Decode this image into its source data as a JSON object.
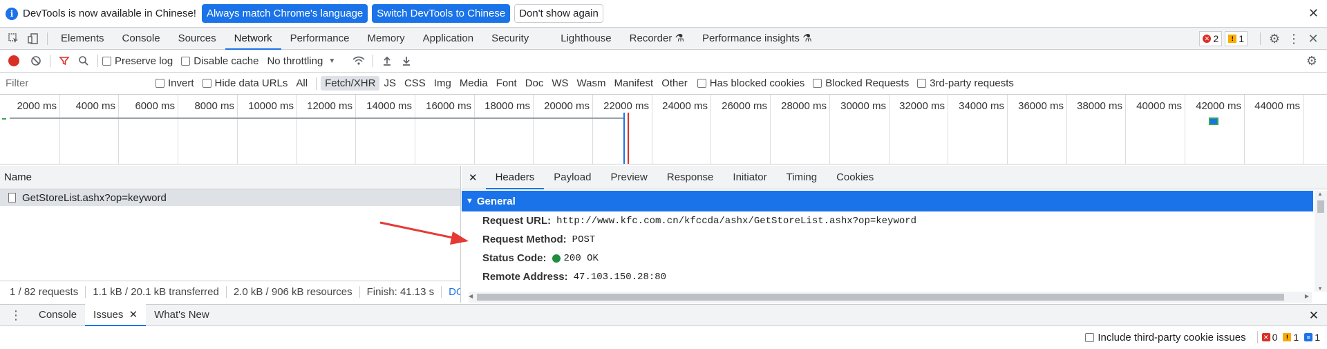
{
  "infobar": {
    "message": "DevTools is now available in Chinese!",
    "btn_match": "Always match Chrome's language",
    "btn_switch": "Switch DevTools to Chinese",
    "btn_dismiss": "Don't show again",
    "close": "✕"
  },
  "tabs": [
    "Elements",
    "Console",
    "Sources",
    "Network",
    "Performance",
    "Memory",
    "Application",
    "Security",
    "Lighthouse",
    "Recorder",
    "Performance insights"
  ],
  "active_tab": "Network",
  "counts": {
    "errors": "2",
    "warnings": "1"
  },
  "toolbar": {
    "preserve_log": "Preserve log",
    "disable_cache": "Disable cache",
    "throttling": "No throttling"
  },
  "filter": {
    "placeholder": "Filter",
    "invert": "Invert",
    "hide_data_urls": "Hide data URLs",
    "types": [
      "All",
      "Fetch/XHR",
      "JS",
      "CSS",
      "Img",
      "Media",
      "Font",
      "Doc",
      "WS",
      "Wasm",
      "Manifest",
      "Other"
    ],
    "selected_type": "Fetch/XHR",
    "has_blocked_cookies": "Has blocked cookies",
    "blocked_requests": "Blocked Requests",
    "third_party": "3rd-party requests"
  },
  "timeline": {
    "ticks": [
      "2000 ms",
      "4000 ms",
      "6000 ms",
      "8000 ms",
      "10000 ms",
      "12000 ms",
      "14000 ms",
      "16000 ms",
      "18000 ms",
      "20000 ms",
      "22000 ms",
      "24000 ms",
      "26000 ms",
      "28000 ms",
      "30000 ms",
      "32000 ms",
      "34000 ms",
      "36000 ms",
      "38000 ms",
      "40000 ms",
      "42000 ms",
      "44000 ms",
      "46"
    ]
  },
  "requests": {
    "column_name": "Name",
    "rows": [
      "GetStoreList.ashx?op=keyword"
    ]
  },
  "status": {
    "requests": "1 / 82 requests",
    "transferred": "1.1 kB / 20.1 kB transferred",
    "resources": "2.0 kB / 906 kB resources",
    "finish": "Finish: 41.13 s",
    "dom": "DO"
  },
  "details": {
    "tabs": [
      "Headers",
      "Payload",
      "Preview",
      "Response",
      "Initiator",
      "Timing",
      "Cookies"
    ],
    "active_tab": "Headers",
    "section": "General",
    "fields": [
      {
        "key": "Request URL:",
        "value": "http://www.kfc.com.cn/kfccda/ashx/GetStoreList.ashx?op=keyword"
      },
      {
        "key": "Request Method:",
        "value": "POST"
      },
      {
        "key": "Status Code:",
        "value": "200 OK"
      },
      {
        "key": "Remote Address:",
        "value": "47.103.150.28:80"
      }
    ]
  },
  "drawer": {
    "tabs": [
      "Console",
      "Issues",
      "What's New"
    ],
    "active_tab": "Issues",
    "include_third_party": "Include third-party cookie issues",
    "counts": {
      "errors": "0",
      "warnings": "1",
      "info": "1"
    }
  },
  "colors": {
    "accent": "#1a73e8",
    "record": "#d93025",
    "annotation_arrow": "#e53935"
  }
}
